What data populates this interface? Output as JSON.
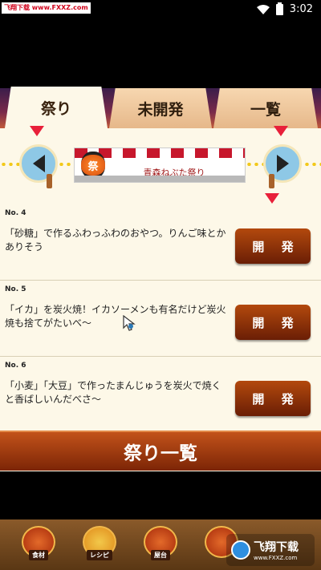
{
  "status_bar": {
    "watermark": "飞翔下载 www.FXXZ.com",
    "time": "3:02"
  },
  "tabs": [
    {
      "label": "祭り"
    },
    {
      "label": "未開発"
    },
    {
      "label": "一覧"
    }
  ],
  "selector": {
    "lantern": "祭",
    "festival_name": "青森ねぶた祭り"
  },
  "items": [
    {
      "no": "No. 4",
      "text": "「砂糖」で作るふわっふわのおやつ。りんご味とかありそう",
      "button": "開 発"
    },
    {
      "no": "No. 5",
      "text": "「イカ」を炭火焼！イカソーメンも有名だけど炭火焼も捨てがたいべ〜",
      "button": "開 発"
    },
    {
      "no": "No. 6",
      "text": "「小麦」「大豆」で作ったまんじゅうを炭火で焼くと香ばしいんだべさ〜",
      "button": "開 発"
    }
  ],
  "list_button": "祭り一覧",
  "bottom_nav": [
    {
      "label": "食材"
    },
    {
      "label": "レシピ"
    },
    {
      "label": "屋台"
    }
  ],
  "watermark_bottom": {
    "title": "飞翔下载",
    "url": "www.FXXZ.com"
  },
  "colors": {
    "accent": "#e8203a",
    "button": "#8a2a08",
    "background": "#fdf8e8"
  }
}
